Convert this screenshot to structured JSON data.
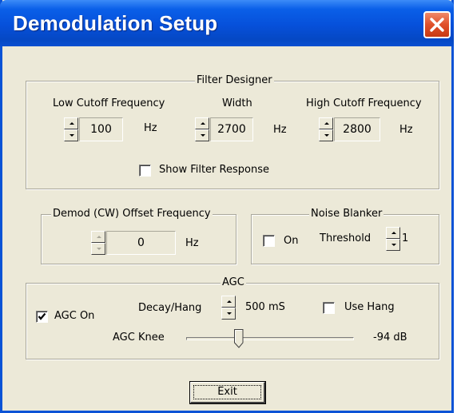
{
  "window": {
    "title": "Demodulation Setup",
    "close_icon": "close-x-icon",
    "colors": {
      "titlebar": "#0650da",
      "close": "#e0502a",
      "face": "#ece9d8"
    }
  },
  "filter_designer": {
    "legend": "Filter Designer",
    "low_cutoff": {
      "label": "Low Cutoff Frequency",
      "value": "100",
      "unit": "Hz"
    },
    "width": {
      "label": "Width",
      "value": "2700",
      "unit": "Hz"
    },
    "high_cutoff": {
      "label": "High Cutoff Frequency",
      "value": "2800",
      "unit": "Hz"
    },
    "show_filter_response": {
      "label": "Show Filter Response",
      "checked": false
    }
  },
  "demod_offset": {
    "legend": "Demod (CW) Offset Frequency",
    "value": "0",
    "unit": "Hz",
    "enabled": false
  },
  "noise_blanker": {
    "legend": "Noise Blanker",
    "on": {
      "label": "On",
      "checked": false
    },
    "threshold_label": "Threshold",
    "threshold_value": "1"
  },
  "agc": {
    "legend": "AGC",
    "agc_on": {
      "label": "AGC On",
      "checked": true
    },
    "decay_label": "Decay/Hang",
    "decay_value": "500 mS",
    "use_hang": {
      "label": "Use Hang",
      "checked": false
    },
    "knee_label": "AGC Knee",
    "knee_value_text": "-94 dB",
    "knee_slider_fraction": 0.31
  },
  "exit_button": {
    "label": "Exit"
  }
}
